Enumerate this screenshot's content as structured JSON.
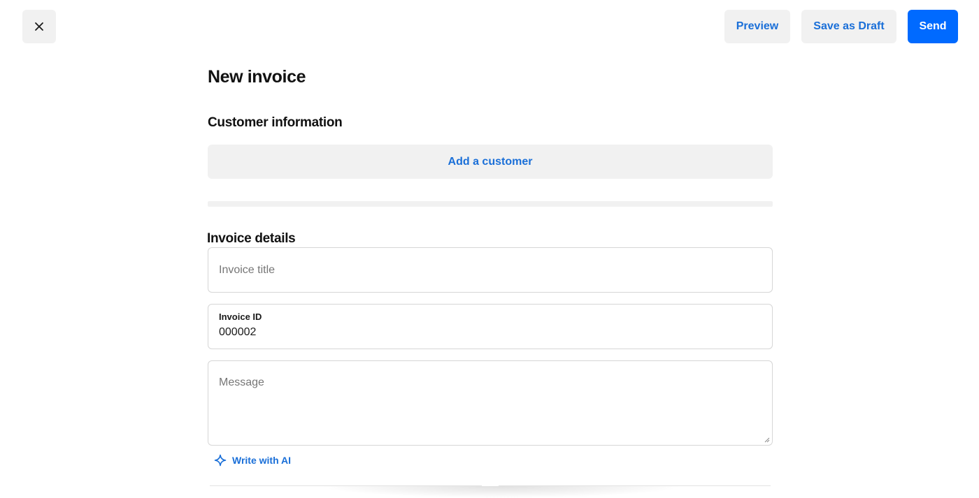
{
  "toolbar": {
    "close_icon": "close-icon",
    "preview_label": "Preview",
    "save_draft_label": "Save as Draft",
    "send_label": "Send"
  },
  "page": {
    "title": "New invoice"
  },
  "customer": {
    "heading": "Customer information",
    "add_label": "Add a customer"
  },
  "details": {
    "heading": "Invoice details",
    "title_placeholder": "Invoice title",
    "id_label": "Invoice ID",
    "id_value": "000002",
    "message_placeholder": "Message",
    "write_ai_label": "Write with AI",
    "write_ai_icon": "sparkle-icon"
  },
  "colors": {
    "accent": "#006aff",
    "link": "#1a6fd8",
    "surface": "#f1f1f1"
  }
}
